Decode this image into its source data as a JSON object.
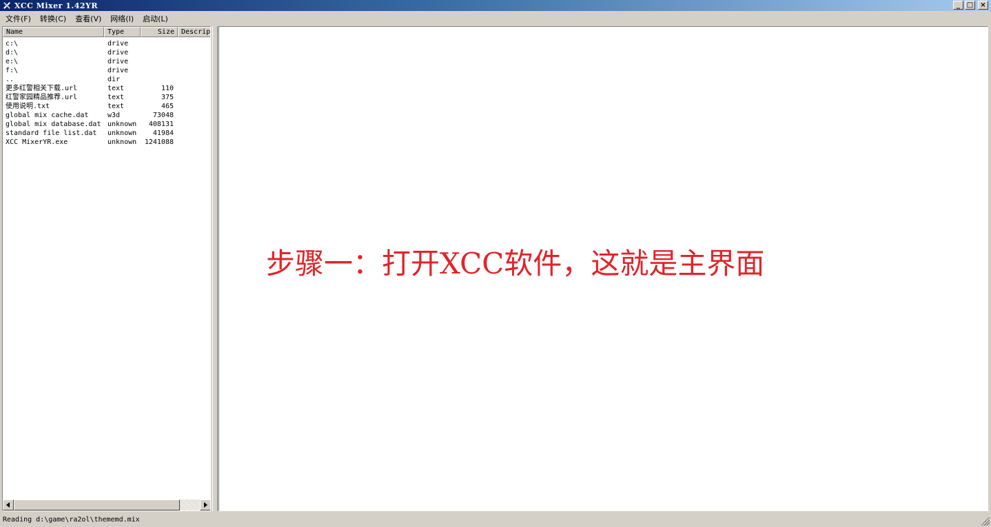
{
  "window": {
    "title": "XCC Mixer 1.42YR",
    "minimize": "_",
    "maximize": "□",
    "close": "×"
  },
  "menu": [
    "文件(F)",
    "转换(C)",
    "查看(V)",
    "网络(I)",
    "启动(L)"
  ],
  "file_list": {
    "columns": [
      "Name",
      "Type",
      "Size",
      "Descrip"
    ],
    "rows": [
      {
        "name": "c:\\",
        "type": "drive",
        "size": ""
      },
      {
        "name": "d:\\",
        "type": "drive",
        "size": ""
      },
      {
        "name": "e:\\",
        "type": "drive",
        "size": ""
      },
      {
        "name": "f:\\",
        "type": "drive",
        "size": ""
      },
      {
        "name": "..",
        "type": "dir",
        "size": ""
      },
      {
        "name": "更多红警相关下载.url",
        "type": "text",
        "size": "110"
      },
      {
        "name": "红警家园精品推荐.url",
        "type": "text",
        "size": "375"
      },
      {
        "name": "使用说明.txt",
        "type": "text",
        "size": "465"
      },
      {
        "name": "global mix cache.dat",
        "type": "w3d",
        "size": "73048"
      },
      {
        "name": "global mix database.dat",
        "type": "unknown",
        "size": "408131"
      },
      {
        "name": "standard file list.dat",
        "type": "unknown",
        "size": "41984"
      },
      {
        "name": "XCC MixerYR.exe",
        "type": "unknown",
        "size": "1241088"
      }
    ]
  },
  "annotation": "步骤一：打开XCC软件，这就是主界面",
  "status": "Reading d:\\game\\ra2ol\\thememd.mix"
}
